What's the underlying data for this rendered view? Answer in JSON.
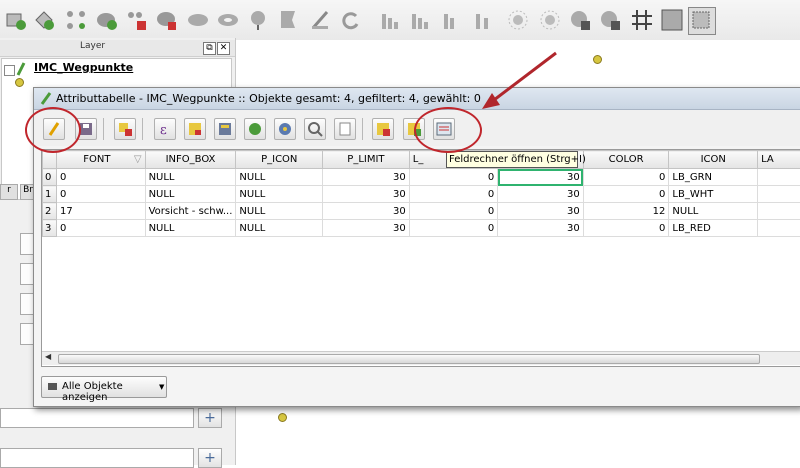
{
  "main_toolbar": {
    "icons": [
      "add-layer-icon",
      "edit-layer-icon",
      "add-feature-icon",
      "paint-icon",
      "remove-icon",
      "edit-polygon-icon",
      "cloud-icon",
      "snake-icon",
      "hedgehog-icon",
      "flag-icon",
      "redo-icon",
      "chart1-icon",
      "chart2-icon",
      "chart3-icon",
      "chart4-icon",
      "sun1-icon",
      "sun2-icon",
      "pin1-icon",
      "pin2-icon",
      "grid-icon",
      "square-icon"
    ]
  },
  "layer_panel": {
    "title": "Layer",
    "float_button": "⧉",
    "close_button": "✕",
    "layer_name": "IMC_Wegpunkte",
    "tab_fragment": "Br"
  },
  "dialog": {
    "title": "Attributtabelle - IMC_Wegpunkte :: Objekte gesamt: 4, gefiltert: 4, gewählt: 0",
    "columns": [
      "FONT",
      "INFO_BOX",
      "P_ICON",
      "P_LIMIT",
      "L_",
      "",
      "COLOR",
      "ICON",
      "LA"
    ],
    "rows": [
      {
        "id": "0",
        "cells": [
          "0",
          "NULL",
          "NULL",
          "30",
          "0",
          "30",
          "0",
          "LB_GRN"
        ]
      },
      {
        "id": "1",
        "cells": [
          "0",
          "NULL",
          "NULL",
          "30",
          "0",
          "30",
          "0",
          "LB_WHT"
        ]
      },
      {
        "id": "2",
        "cells": [
          "17",
          "Vorsicht - schw...",
          "NULL",
          "30",
          "0",
          "30",
          "12",
          "NULL"
        ]
      },
      {
        "id": "3",
        "cells": [
          "0",
          "NULL",
          "NULL",
          "30",
          "0",
          "30",
          "0",
          "LB_RED"
        ]
      }
    ],
    "show_all_button": "Alle Objekte anzeigen",
    "tooltip": "Feldrechner öffnen (Strg+I)"
  },
  "colors": {
    "annotation_red": "#c0262c",
    "selection_green": "#2fb36f",
    "map_point": "#d6c640"
  }
}
